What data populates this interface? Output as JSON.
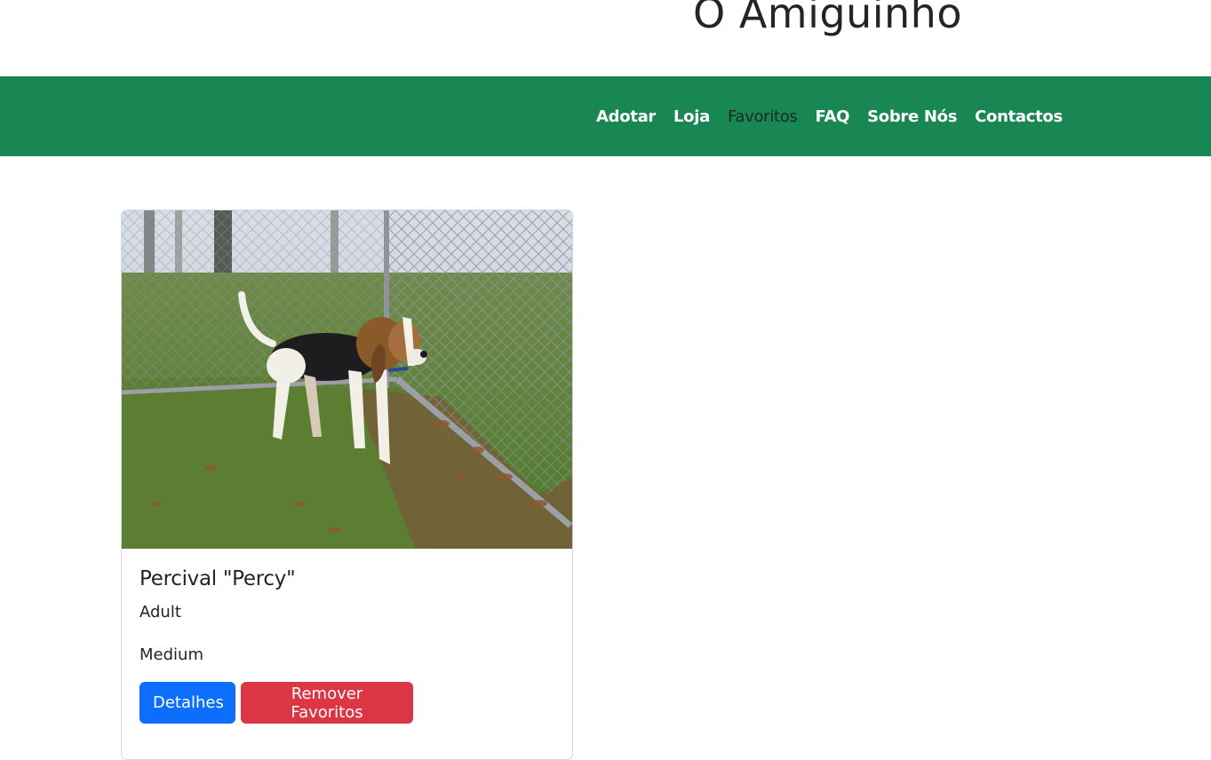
{
  "header": {
    "site_title": "O Amiguinho"
  },
  "nav": {
    "items": [
      {
        "label": "Adotar"
      },
      {
        "label": "Loja"
      },
      {
        "label": "Favoritos",
        "active": true
      },
      {
        "label": "FAQ"
      },
      {
        "label": "Sobre Nós"
      },
      {
        "label": "Contactos"
      }
    ]
  },
  "favorites": [
    {
      "name": "Percival \"Percy\"",
      "age": "Adult",
      "size": "Medium",
      "details_label": "Detalhes",
      "remove_label": "Remover Favoritos"
    }
  ],
  "colors": {
    "navbar_bg": "#198754",
    "primary": "#0d6efd",
    "danger": "#dc3545"
  }
}
